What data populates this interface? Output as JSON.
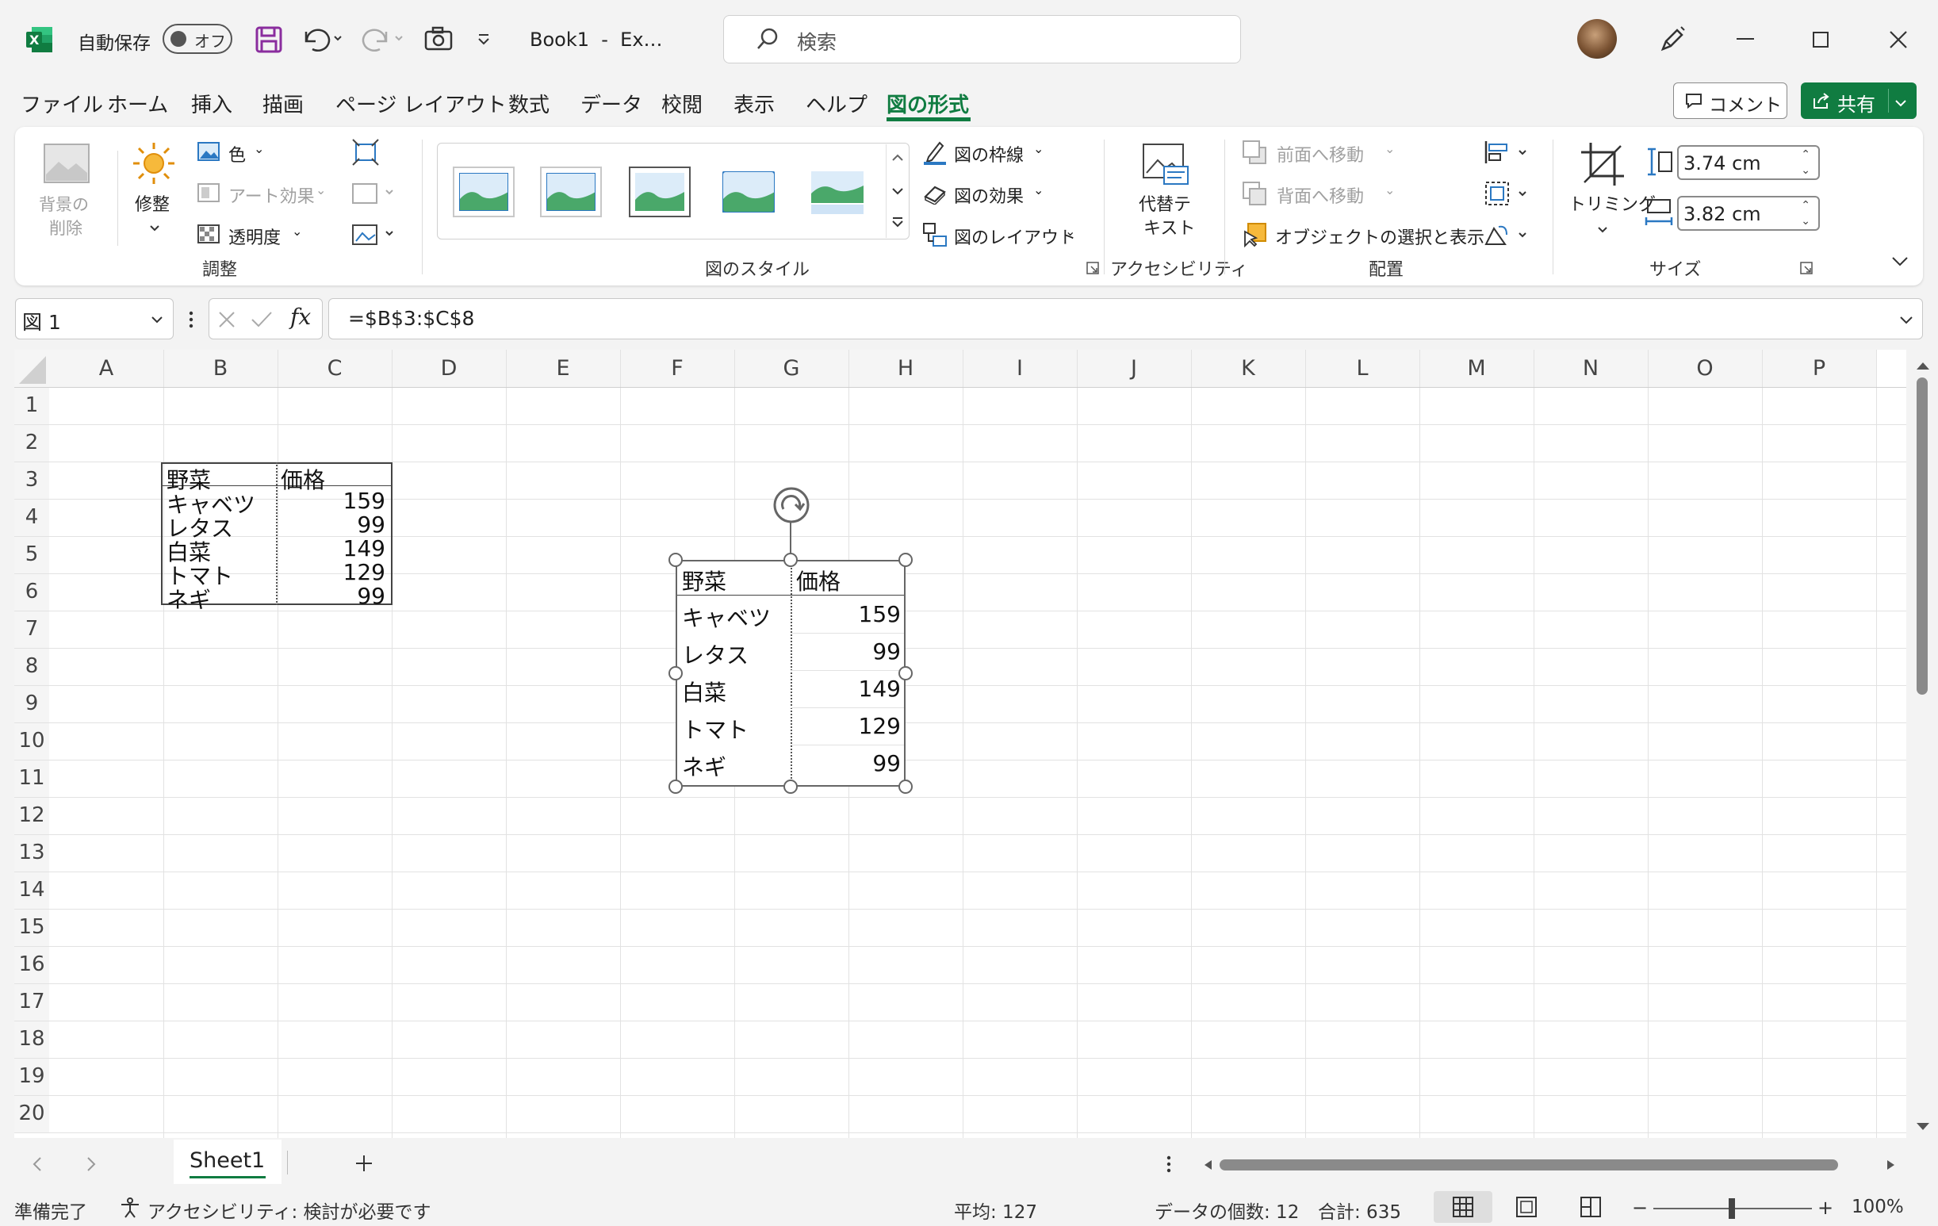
{
  "titlebar": {
    "autosave_label": "自動保存",
    "autosave_state": "オフ",
    "title": "Book1  -  Ex…",
    "search_placeholder": "検索"
  },
  "tabs": [
    "ファイル",
    "ホーム",
    "挿入",
    "描画",
    "ページ レイアウト",
    "数式",
    "データ",
    "校閲",
    "表示",
    "ヘルプ",
    "図の形式"
  ],
  "active_tab": "図の形式",
  "header_buttons": {
    "comment": "コメント",
    "share": "共有"
  },
  "ribbon": {
    "remove_bg": [
      "背景の",
      "削除"
    ],
    "corrections": "修整",
    "color": "色",
    "art_effects": "アート効果",
    "transparency": "透明度",
    "group_adjust": "調整",
    "group_styles": "図のスタイル",
    "border": "図の枠線",
    "effects": "図の効果",
    "layout": "図のレイアウト",
    "alt_text": [
      "代替テ",
      "キスト"
    ],
    "group_accessibility": "アクセシビリティ",
    "bring_forward": "前面へ移動",
    "send_backward": "背面へ移動",
    "selection_pane": "オブジェクトの選択と表示",
    "group_arrange": "配置",
    "crop": "トリミング",
    "height": "3.74 cm",
    "width": "3.82 cm",
    "group_size": "サイズ"
  },
  "formula_bar": {
    "name_box": "図 1",
    "formula": "=$B$3:$C$8"
  },
  "columns": [
    "A",
    "B",
    "C",
    "D",
    "E",
    "F",
    "G",
    "H",
    "I",
    "J",
    "K",
    "L",
    "M",
    "N",
    "O",
    "P"
  ],
  "rows": [
    "1",
    "2",
    "3",
    "4",
    "5",
    "6",
    "7",
    "8",
    "9",
    "10",
    "11",
    "12",
    "13",
    "14",
    "15",
    "16",
    "17",
    "18",
    "19",
    "20"
  ],
  "table": {
    "headers": [
      "野菜",
      "価格"
    ],
    "rows": [
      [
        "キャベツ",
        "159"
      ],
      [
        "レタス",
        "99"
      ],
      [
        "白菜",
        "149"
      ],
      [
        "トマト",
        "129"
      ],
      [
        "ネギ",
        "99"
      ]
    ]
  },
  "sheet_tab": "Sheet1",
  "status": {
    "ready": "準備完了",
    "accessibility": "アクセシビリティ: 検討が必要です",
    "average": "平均: 127",
    "count": "データの個数: 12",
    "sum": "合計: 635",
    "zoom": "100%"
  },
  "colors": {
    "accent": "#107c41",
    "share_bg": "#107c41"
  }
}
